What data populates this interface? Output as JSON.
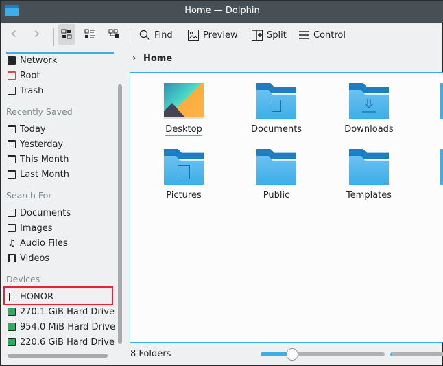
{
  "window": {
    "title": "Home — Dolphin",
    "app_icon": "folder-icon"
  },
  "toolbar": {
    "back": "‹",
    "forward": "›",
    "find": "Find",
    "preview": "Preview",
    "split": "Split",
    "control": "Control"
  },
  "breadcrumb": {
    "current": "Home"
  },
  "sidebar": {
    "places": [
      {
        "label": "Network",
        "icon": "network-icon"
      },
      {
        "label": "Root",
        "icon": "root-folder-icon"
      },
      {
        "label": "Trash",
        "icon": "trash-icon"
      }
    ],
    "recent_header": "Recently Saved",
    "recent": [
      {
        "label": "Today"
      },
      {
        "label": "Yesterday"
      },
      {
        "label": "This Month"
      },
      {
        "label": "Last Month"
      }
    ],
    "search_header": "Search For",
    "search": [
      {
        "label": "Documents"
      },
      {
        "label": "Images"
      },
      {
        "label": "Audio Files"
      },
      {
        "label": "Videos"
      }
    ],
    "devices_header": "Devices",
    "devices": [
      {
        "label": "HONOR",
        "icon": "phone-icon"
      },
      {
        "label": "270.1 GiB Hard Drive"
      },
      {
        "label": "954.0 MiB Hard Drive"
      },
      {
        "label": "220.6 GiB Hard Drive"
      }
    ]
  },
  "files": [
    {
      "name": "Desktop"
    },
    {
      "name": "Documents"
    },
    {
      "name": "Downloads"
    },
    {
      "name": "Pictures"
    },
    {
      "name": "Public"
    },
    {
      "name": "Templates"
    }
  ],
  "status": {
    "text": "8 Folders",
    "zoom_fraction": 0.2
  },
  "colors": {
    "accent": "#3daee9",
    "highlight": "#e8213a",
    "titlebar": "#475057"
  }
}
